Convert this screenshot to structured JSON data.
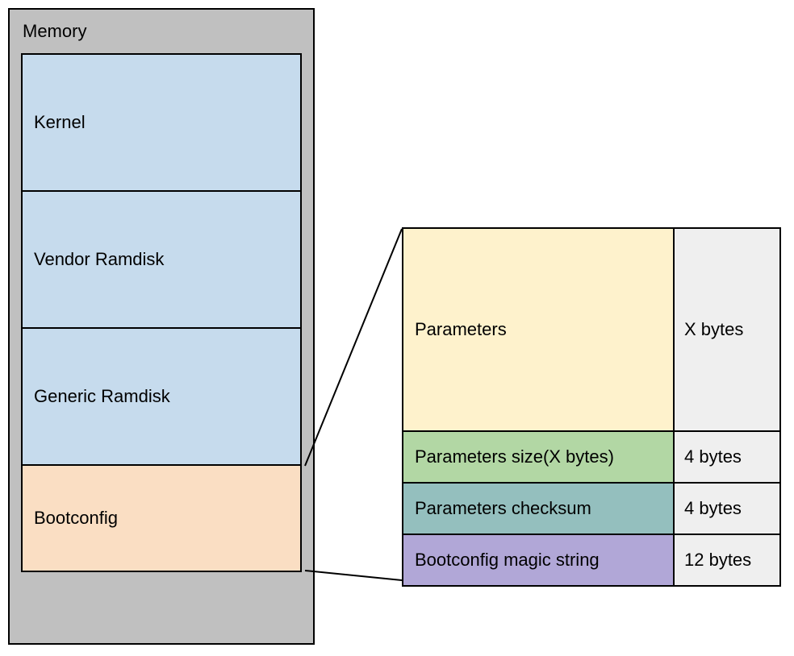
{
  "memory": {
    "title": "Memory",
    "rows": {
      "kernel": "Kernel",
      "vendor": "Vendor Ramdisk",
      "generic": "Generic Ramdisk",
      "bootconfig": "Bootconfig"
    }
  },
  "detail": {
    "params": {
      "label": "Parameters",
      "size": "X bytes"
    },
    "psize": {
      "label": "Parameters size(X bytes)",
      "size": "4 bytes"
    },
    "checksum": {
      "label": "Parameters checksum",
      "size": "4 bytes"
    },
    "magic": {
      "label": "Bootconfig magic string",
      "size": "12 bytes"
    }
  },
  "colors": {
    "memory_bg": "#c0c0c0",
    "kernel_bg": "#c6dbed",
    "bootconfig_bg": "#fadec3",
    "params_bg": "#fef2cc",
    "psize_bg": "#b2d7a4",
    "checksum_bg": "#94bfbe",
    "magic_bg": "#b1a7d7",
    "size_col_bg": "#efefef"
  }
}
